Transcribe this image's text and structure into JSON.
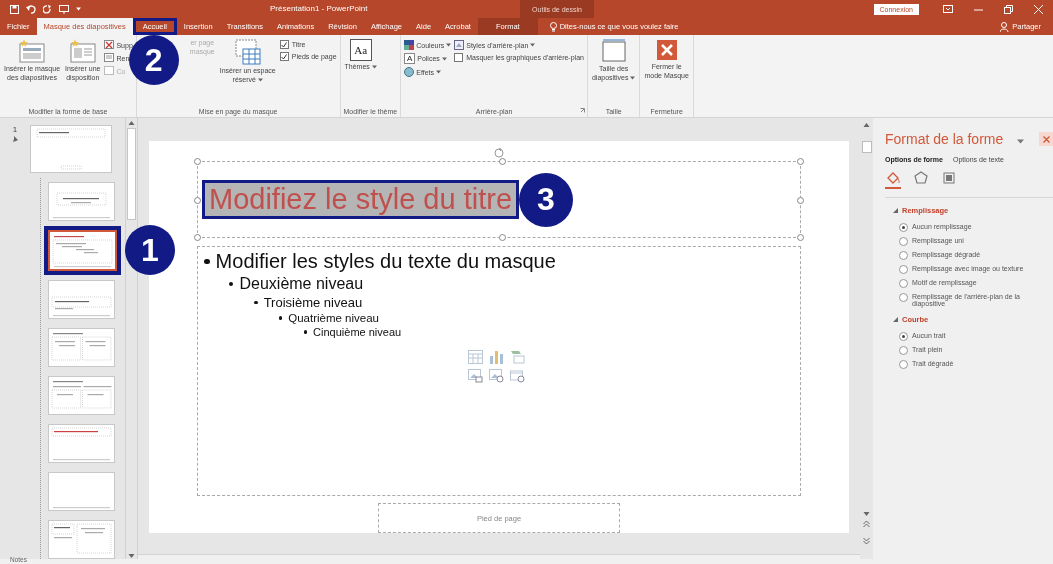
{
  "title_bar": {
    "title": "Présentation1  -  PowerPoint",
    "contextual_group": "Outils de dessin",
    "sign_in": "Connexion"
  },
  "tabs": [
    {
      "label": "Fichier",
      "kind": "file",
      "selected": false
    },
    {
      "label": "Masque des diapositives",
      "kind": "normal",
      "selected": true
    },
    {
      "label": "Accueil",
      "kind": "normal",
      "selected": false,
      "annotation": "2"
    },
    {
      "label": "Insertion",
      "kind": "normal",
      "selected": false
    },
    {
      "label": "Transitions",
      "kind": "normal",
      "selected": false
    },
    {
      "label": "Animations",
      "kind": "normal",
      "selected": false
    },
    {
      "label": "Révision",
      "kind": "normal",
      "selected": false
    },
    {
      "label": "Affichage",
      "kind": "normal",
      "selected": false
    },
    {
      "label": "Aide",
      "kind": "normal",
      "selected": false
    },
    {
      "label": "Acrobat",
      "kind": "normal",
      "selected": false
    },
    {
      "label": "Format",
      "kind": "contextual",
      "selected": false
    }
  ],
  "tell_me": "Dites-nous ce que vous voulez faire",
  "share": "Partager",
  "ribbon": {
    "groups": [
      {
        "label": "Modifier la forme de base",
        "items": [
          {
            "kind": "large",
            "label": "Insérer le masque\ndes diapositives"
          },
          {
            "kind": "large",
            "label": "Insérer une\ndisposition"
          },
          {
            "kind": "stack",
            "items": [
              {
                "kind": "small",
                "label": "Supp"
              },
              {
                "kind": "small",
                "label": "Ren"
              },
              {
                "kind": "small",
                "label": "Co",
                "disabled": true
              }
            ]
          }
        ]
      },
      {
        "label": "Mise en page du masque",
        "items": [
          {
            "kind": "large",
            "label": "er page\nmasque",
            "disabled": true
          },
          {
            "kind": "large",
            "label": "Insérer un espace\nréservé",
            "dropdown": true
          },
          {
            "kind": "stack",
            "items": [
              {
                "kind": "check",
                "label": "Titre",
                "checked": true
              },
              {
                "kind": "check",
                "label": "Pieds de page",
                "checked": true
              }
            ]
          }
        ]
      },
      {
        "label": "Modifier le thème",
        "items": [
          {
            "kind": "large",
            "label": "Thèmes",
            "glyph": "Aa",
            "dropdown": true
          }
        ]
      },
      {
        "label": "Arrière-plan",
        "launcher": true,
        "items": [
          {
            "kind": "stack",
            "items": [
              {
                "kind": "small",
                "label": "Couleurs",
                "dropdown": true
              },
              {
                "kind": "small",
                "label": "Polices",
                "glyph": "A",
                "dropdown": true
              },
              {
                "kind": "small",
                "label": "Effets",
                "dropdown": true
              }
            ]
          },
          {
            "kind": "stack",
            "items": [
              {
                "kind": "small",
                "label": "Styles d'arrière-plan",
                "dropdown": true
              },
              {
                "kind": "check",
                "label": "Masquer les graphiques d'arrière-plan",
                "checked": false
              }
            ]
          }
        ]
      },
      {
        "label": "Taille",
        "items": [
          {
            "kind": "large",
            "label": "Taille des\ndiapositives",
            "dropdown": true
          }
        ]
      },
      {
        "label": "Fermeture",
        "items": [
          {
            "kind": "large",
            "label": "Fermer le\nmode Masque"
          }
        ]
      }
    ]
  },
  "thumbnails": [
    {
      "number": "1",
      "kind": "master",
      "selected": false
    },
    {
      "kind": "title",
      "selected": false
    },
    {
      "kind": "content",
      "selected": true,
      "annotation": "1"
    },
    {
      "kind": "section",
      "selected": false
    },
    {
      "kind": "two",
      "selected": false
    },
    {
      "kind": "compare",
      "selected": false
    },
    {
      "kind": "title_only",
      "selected": false
    },
    {
      "kind": "blank",
      "selected": false
    },
    {
      "kind": "caption",
      "selected": false
    }
  ],
  "slide": {
    "title": "Modifiez le style du titre",
    "title_annotation": "3",
    "body": [
      {
        "text": "Modifier les styles du texte du masque",
        "children": [
          {
            "text": "Deuxième niveau",
            "children": [
              {
                "text": "Troisième niveau",
                "children": [
                  {
                    "text": "Quatrième niveau",
                    "children": [
                      {
                        "text": "Cinquième niveau"
                      }
                    ]
                  }
                ]
              }
            ]
          }
        ]
      }
    ],
    "footer": "Pied de page"
  },
  "pane": {
    "title": "Format de la forme",
    "tabs": [
      {
        "label": "Options de forme",
        "selected": true
      },
      {
        "label": "Options de texte",
        "selected": false
      }
    ],
    "icon_tabs": [
      {
        "kind": "fill",
        "selected": true
      },
      {
        "kind": "shape",
        "selected": false
      },
      {
        "kind": "size",
        "selected": false
      }
    ],
    "sections": [
      {
        "label": "Remplissage",
        "expanded": true,
        "options": [
          {
            "label": "Aucun remplissage",
            "selected": true
          },
          {
            "label": "Remplissage uni",
            "selected": false
          },
          {
            "label": "Remplissage dégradé",
            "selected": false
          },
          {
            "label": "Remplissage avec image ou texture",
            "selected": false
          },
          {
            "label": "Motif de remplissage",
            "selected": false
          },
          {
            "label": "Remplissage de l'arrière-plan de la diapositive",
            "selected": false
          }
        ]
      },
      {
        "label": "Courbe",
        "expanded": true,
        "options": [
          {
            "label": "Aucun trait",
            "selected": true
          },
          {
            "label": "Trait plein",
            "selected": false
          },
          {
            "label": "Trait dégradé",
            "selected": false
          }
        ]
      }
    ]
  },
  "status_bar": {
    "notes": "Notes"
  }
}
